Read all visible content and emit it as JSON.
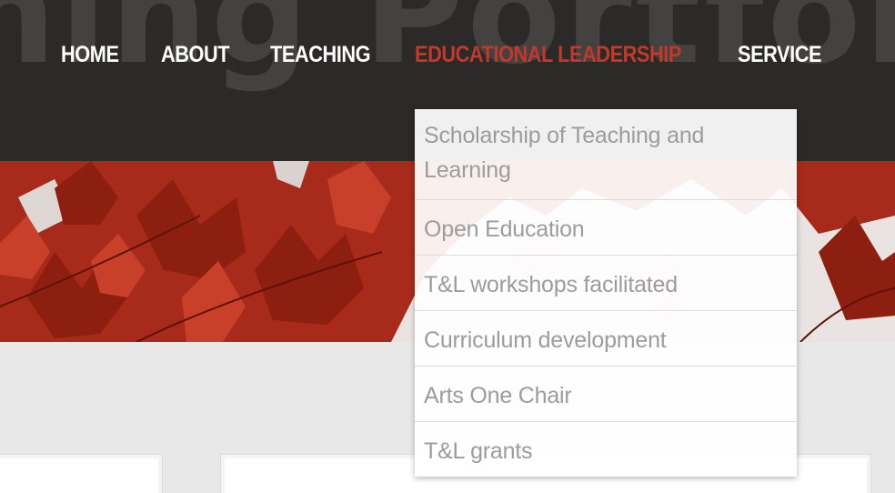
{
  "site": {
    "title_fragment": "ning Portfolio"
  },
  "nav": {
    "items": [
      {
        "label": "HOME"
      },
      {
        "label": "ABOUT"
      },
      {
        "label": "TEACHING"
      },
      {
        "label": "EDUCATIONAL LEADERSHIP",
        "active": true
      },
      {
        "label": "SERVICE"
      }
    ]
  },
  "dropdown": {
    "items": [
      {
        "label": "Scholarship of Teaching and Learning"
      },
      {
        "label": "Open Education"
      },
      {
        "label": "T&L workshops facilitated"
      },
      {
        "label": "Curriculum development"
      },
      {
        "label": "Arts One Chair"
      },
      {
        "label": "T&L grants"
      }
    ]
  },
  "colors": {
    "header_bg": "#2b2a29",
    "active_nav": "#c0392b",
    "nav_text": "#ffffff",
    "dropdown_text": "#9c9c9c"
  }
}
